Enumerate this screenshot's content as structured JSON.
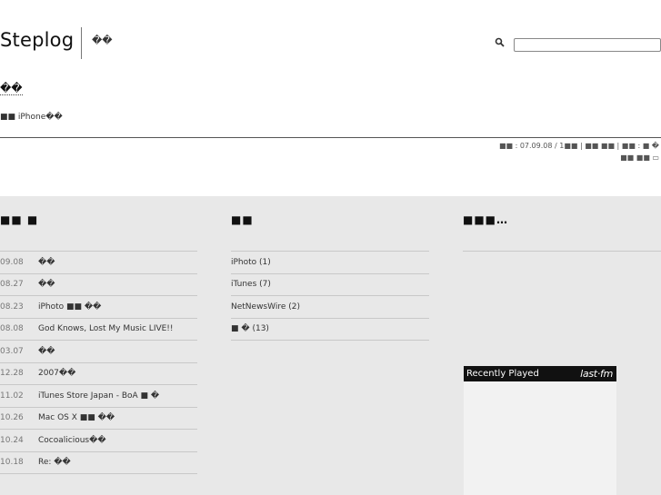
{
  "header": {
    "site_title": "Steplog",
    "tagline": "��",
    "search_icon": "search-icon",
    "search_value": ""
  },
  "entry": {
    "title": "��",
    "breadcrumb": "■■ iPhone��",
    "meta_line1": "■■ : 07.09.08 / 1■■ | ■■ ■■ | ■■ : ■ �",
    "meta_line2": "■■ ■■ ▭"
  },
  "columns": {
    "recent": {
      "title": "■■ ■",
      "items": [
        {
          "date": "09.08",
          "title": "��"
        },
        {
          "date": "08.27",
          "title": "��"
        },
        {
          "date": "08.23",
          "title": "iPhoto ■■ ��"
        },
        {
          "date": "08.08",
          "title": "God Knows, Lost My Music LIVE!!"
        },
        {
          "date": "03.07",
          "title": "��"
        },
        {
          "date": "12.28",
          "title": "2007��"
        },
        {
          "date": "11.02",
          "title": "iTunes Store Japan - BoA ■ �"
        },
        {
          "date": "10.26",
          "title": "Mac OS X ■■ ��"
        },
        {
          "date": "10.24",
          "title": "Cocoalicious��"
        },
        {
          "date": "10.18",
          "title": "Re: ��"
        }
      ]
    },
    "categories": {
      "title": "■■",
      "items": [
        {
          "label": "iPhoto (1)"
        },
        {
          "label": "iTunes (7)"
        },
        {
          "label": "NetNewsWire (2)"
        },
        {
          "label": "■ � (13)"
        }
      ]
    },
    "third": {
      "title": "■■■…"
    }
  },
  "lastfm": {
    "title": "Recently Played",
    "logo": "last·fm"
  }
}
